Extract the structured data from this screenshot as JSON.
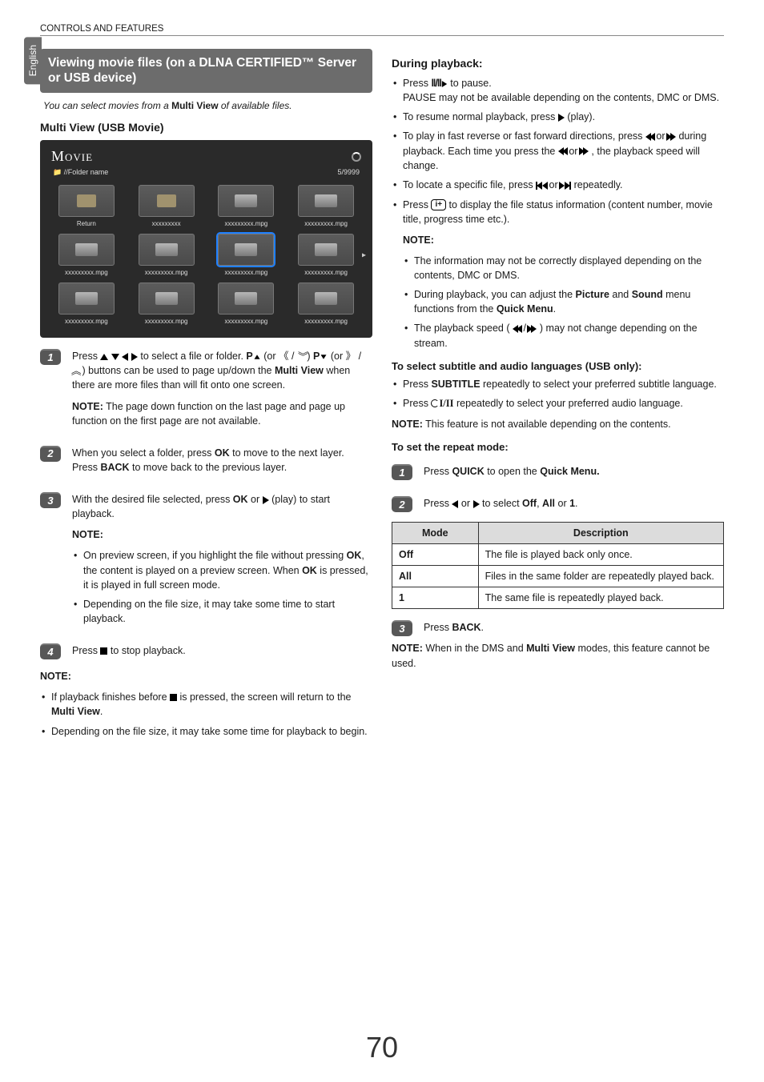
{
  "header": {
    "section": "CONTROLS AND FEATURES"
  },
  "lang_tab": "English",
  "page_number": "70",
  "left": {
    "title_band": "Viewing movie files (on a DLNA CERTIFIED™ Server or USB device)",
    "caption_pre": "You can select movies from a ",
    "caption_bold": "Multi View",
    "caption_post": " of available files.",
    "subheading": "Multi View (USB Movie)",
    "movie_ui": {
      "title": "Movie",
      "folder_path": "//Folder name",
      "count": "5/9999",
      "thumbs": [
        {
          "label": "Return",
          "kind": "folder"
        },
        {
          "label": "xxxxxxxxx",
          "kind": "folder"
        },
        {
          "label": "xxxxxxxxx.mpg",
          "kind": "file"
        },
        {
          "label": "xxxxxxxxx.mpg",
          "kind": "file"
        },
        {
          "label": "xxxxxxxxx.mpg",
          "kind": "file"
        },
        {
          "label": "xxxxxxxxx.mpg",
          "kind": "file"
        },
        {
          "label": "xxxxxxxxx.mpg",
          "kind": "file",
          "selected": true
        },
        {
          "label": "xxxxxxxxx.mpg",
          "kind": "file"
        },
        {
          "label": "xxxxxxxxx.mpg",
          "kind": "file"
        },
        {
          "label": "xxxxxxxxx.mpg",
          "kind": "file"
        },
        {
          "label": "xxxxxxxxx.mpg",
          "kind": "file"
        },
        {
          "label": "xxxxxxxxx.mpg",
          "kind": "file"
        }
      ]
    },
    "steps": {
      "s1": {
        "t1": "Press ",
        "t2": " to select a file or folder. ",
        "t3a": "P",
        "t3b": " (or ",
        "t4a": "P",
        "t4b": " (or ",
        "t5": ") buttons can be used to page up/down the ",
        "t5b": "Multi View",
        "t5c": " when there are more files than will fit onto one screen.",
        "note_label": "NOTE:",
        "note_text": " The page down function on the last page and page up function on the first page are not available."
      },
      "s2": {
        "t1": "When you select a folder, press ",
        "t2": "OK",
        "t3": " to move to the next layer. Press ",
        "t4": "BACK",
        "t5": " to move back to the previous layer."
      },
      "s3": {
        "t1": "With the desired file selected, press ",
        "t2": "OK",
        "t3": " or ",
        "t4": " (play) to start playback.",
        "note_head": "NOTE:",
        "note_b1a": "On preview screen, if you highlight the file without pressing ",
        "note_b1b": "OK",
        "note_b1c": ", the content is played on a preview screen. When ",
        "note_b1d": "OK",
        "note_b1e": " is pressed, it is played in full screen mode.",
        "note_b2": "Depending on the file size, it may take some time to start playback."
      },
      "s4": {
        "t1": "Press ",
        "t2": " to stop playback."
      }
    },
    "bottom_note": {
      "head": "NOTE:",
      "b1a": "If playback finishes before ",
      "b1b": " is pressed, the screen will return to the ",
      "b1c": "Multi View",
      "b1d": ".",
      "b2": "Depending on the file size, it may take some time for playback to begin."
    }
  },
  "right": {
    "h1": "During playback:",
    "bul1": {
      "a1": "Press ",
      "a2": " to pause.",
      "a3": "PAUSE may not be available depending on the contents, DMC or DMS.",
      "b1": "To resume normal playback, press ",
      "b2": " (play).",
      "c1": "To play in fast reverse or fast forward directions, press ",
      "c2": " or ",
      "c3": " during playback. Each time you press the ",
      "c4": " or ",
      "c5": ", the playback speed will change.",
      "d1": "To locate a specific file, press ",
      "d2": " or ",
      "d3": " repeatedly.",
      "e1": "Press ",
      "e2": " to display the file status information (content number, movie title, progress time etc.)."
    },
    "note1": {
      "head": "NOTE:",
      "b1": "The information may not be correctly displayed depending on the contents, DMC or DMS.",
      "b2a": "During playback, you can adjust the ",
      "b2b": "Picture",
      "b2c": " and ",
      "b2d": "Sound",
      "b2e": " menu functions from the ",
      "b2f": "Quick Menu",
      "b2g": ".",
      "b3a": "The playback speed (",
      "b3b": ") may not change depending on the stream."
    },
    "h2": "To select subtitle and audio languages (USB only):",
    "bul2": {
      "a1": "Press ",
      "a2": "SUBTITLE",
      "a3": " repeatedly to select your preferred subtitle language.",
      "b1": "Press ",
      "b2": " repeatedly to select your preferred audio language."
    },
    "note2": {
      "label": "NOTE:",
      "text": " This feature is not available depending on the contents."
    },
    "h3": "To set the repeat mode:",
    "rsteps": {
      "s1a": "Press ",
      "s1b": "QUICK",
      "s1c": " to open the ",
      "s1d": "Quick Menu.",
      "s2a": "Press ",
      "s2b": " or ",
      "s2c": " to select ",
      "s2d": "Off",
      "s2e": ", ",
      "s2f": "All",
      "s2g": " or ",
      "s2h": "1",
      "s2i": "."
    },
    "table": {
      "h_mode": "Mode",
      "h_desc": "Description",
      "rows": [
        {
          "mode": "Off",
          "desc": "The file is played back only once."
        },
        {
          "mode": "All",
          "desc": "Files in the same folder are repeatedly played back."
        },
        {
          "mode": "1",
          "desc": "The same file is repeatedly played back."
        }
      ],
      "s3a": "Press ",
      "s3b": "BACK",
      "s3c": "."
    },
    "note3": {
      "label": "NOTE:",
      "t1": " When in the DMS and ",
      "t2": "Multi View",
      "t3": " modes, this feature cannot be used."
    }
  }
}
